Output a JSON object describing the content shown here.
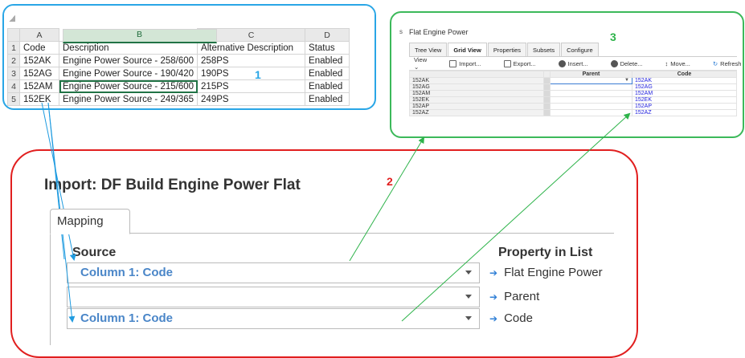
{
  "excel": {
    "columns": [
      "A",
      "B",
      "C",
      "D"
    ],
    "header_row": {
      "row_num": "1",
      "cells": [
        "Code",
        "Description",
        "Alternative Description",
        "Status"
      ]
    },
    "rows": [
      {
        "row_num": "2",
        "cells": [
          "152AK",
          "Engine Power Source - 258/600",
          "258PS",
          "Enabled"
        ]
      },
      {
        "row_num": "3",
        "cells": [
          "152AG",
          "Engine Power Source - 190/420",
          "190PS",
          "Enabled"
        ]
      },
      {
        "row_num": "4",
        "cells": [
          "152AM",
          "Engine Power Source - 215/600",
          "215PS",
          "Enabled"
        ]
      },
      {
        "row_num": "5",
        "cells": [
          "152EK",
          "Engine Power Source - 249/365",
          "249PS",
          "Enabled"
        ]
      }
    ],
    "marker": "1"
  },
  "grid": {
    "prefix": "s",
    "title": "Flat Engine Power",
    "tabs": [
      "Tree View",
      "Grid View",
      "Properties",
      "Subsets",
      "Configure"
    ],
    "active_tab": "Grid View",
    "toolbar": [
      "View ⌄",
      "Import...",
      "Export...",
      "Insert...",
      "Delete...",
      "Move...",
      "Refresh"
    ],
    "columns": [
      "Parent",
      "Code"
    ],
    "rows": [
      {
        "name": "152AK",
        "code": "152AK"
      },
      {
        "name": "152AG",
        "code": "152AG"
      },
      {
        "name": "152AM",
        "code": "152AM"
      },
      {
        "name": "152EK",
        "code": "152EK"
      },
      {
        "name": "152AP",
        "code": "152AP"
      },
      {
        "name": "152AZ",
        "code": "152AZ"
      }
    ],
    "marker": "3"
  },
  "import": {
    "title": "Import: DF Build Engine Power Flat",
    "tab": "Mapping",
    "source_header": "Source",
    "property_header": "Property in List",
    "mappings": [
      {
        "source": "Column 1: Code",
        "property": "Flat Engine Power"
      },
      {
        "source": "",
        "property": "Parent"
      },
      {
        "source": "Column 1: Code",
        "property": "Code"
      }
    ],
    "marker": "2"
  },
  "colors": {
    "excel_border": "#29a6e6",
    "grid_border": "#3cb95a",
    "import_border": "#e11f1f",
    "arrow_blue": "#1f9be0",
    "arrow_green": "#2db34a"
  }
}
